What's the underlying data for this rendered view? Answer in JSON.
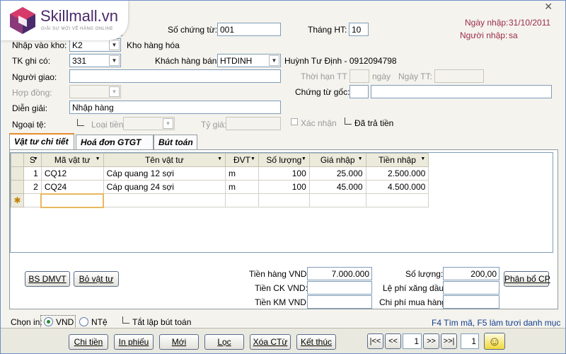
{
  "logo": {
    "brand": "Skillmall.vn",
    "tagline": "GIẢI SỰ MỚI VỀ HÀNG ONLINE"
  },
  "header": {
    "so_chung_tu_label": "Số chứng từ:",
    "so_chung_tu_value": "001",
    "thang_ht_label": "Tháng HT:",
    "thang_ht_value": "10",
    "ngay_nhap_label": "Ngày nhập:",
    "ngay_nhap_value": "31/10/2011",
    "nguoi_nhap_label": "Người nhập:",
    "nguoi_nhap_value": "sa",
    "top_left_value": "1"
  },
  "form": {
    "nhap_vao_kho_label": "Nhập vào kho:",
    "nhap_vao_kho_value": "K2",
    "kho_name": "Kho hàng hóa",
    "tk_ghi_co_label": "TK ghi có:",
    "tk_ghi_co_value": "331",
    "khach_hang_ban_label": "Khách hàng bán:",
    "khach_hang_ban_value": "HTDINH",
    "khach_hang_name": "Huỳnh Tư Định - 0912094798",
    "nguoi_giao_label": "Người giao:",
    "thoi_han_tt_label": "Thời hạn TT",
    "ngay_label": "ngày",
    "ngay_tt_label": "Ngày TT:",
    "hop_dong_label": "Hợp đồng:",
    "chung_tu_goc_label": "Chứng từ gốc:",
    "dien_giai_label": "Diễn giải:",
    "dien_giai_value": "Nhập hàng",
    "ngoai_te_label": "Ngoại tệ:",
    "loai_tien_label": "Loại tiền:",
    "ty_gia_label": "Tỷ giá:",
    "xac_nhan_label": "Xác nhận",
    "da_tra_tien_label": "Đã trả tiền"
  },
  "tabs": [
    {
      "label": "Vật tư chi tiết",
      "active": true
    },
    {
      "label": "Hoá đơn GTGT",
      "active": false
    },
    {
      "label": "Bút toán",
      "active": false
    }
  ],
  "grid": {
    "columns": [
      "S",
      "Mã vật tư",
      "Tên vật tư",
      "ĐVT",
      "Số lượng",
      "Giá nhập",
      "Tiền nhập"
    ],
    "rows": [
      {
        "stt": "1",
        "ma": "CQ12",
        "ten": "Cáp quang 12 sợi",
        "dvt": "m",
        "so_luong": "100",
        "gia": "25.000",
        "tien": "2.500.000"
      },
      {
        "stt": "2",
        "ma": "CQ24",
        "ten": "Cáp quang 24 sợi",
        "dvt": "m",
        "so_luong": "100",
        "gia": "45.000",
        "tien": "4.500.000"
      }
    ],
    "new_row_marker": "✱"
  },
  "summary": {
    "bs_dmvt": "BS DMVT",
    "bo_vat_tu": "Bỏ vật tư",
    "tien_hang_label": "Tiền hàng VND:",
    "tien_hang_value": "7.000.000",
    "tien_ck_label": "Tiền CK VND:",
    "tien_km_label": "Tiền KM VND:",
    "so_luong_label": "Số lượng:",
    "so_luong_value": "200,00",
    "le_phi_label": "Lệ phí xăng dầu:",
    "chi_phi_label": "Chi phí mua hàng:",
    "phan_bo_cp": "Phân bổ CP"
  },
  "footer_opts": {
    "chon_in_label": "Chọn in:",
    "vnd_label": "VND",
    "nte_label": "NTệ",
    "tat_lap_label": "Tắt lập bút toán",
    "hint": "F4 Tìm mã, F5 làm tươi danh mục"
  },
  "bottom": {
    "buttons": [
      "Chi tiền",
      "In phiếu",
      "Mới",
      "Lọc",
      "Xóa CTừ",
      "Kết thúc"
    ],
    "nav": [
      "|<<",
      "<<",
      ">>",
      ">>|"
    ],
    "page_current": "1",
    "page_total": "1",
    "smiley": "☺"
  },
  "colors": {
    "accent_red": "#9b2c46",
    "tab_active_border": "#e68b2c",
    "logo_pink": "#d63a6a",
    "logo_purple": "#4a2a6a"
  }
}
